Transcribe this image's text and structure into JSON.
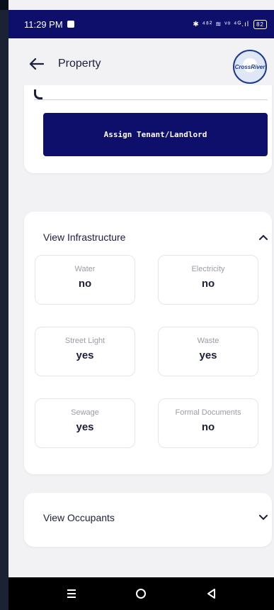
{
  "status_bar": {
    "time": "11:29 PM",
    "icons": "✱ ⁴⁸² ≋ ᵛᵒ ⁴ᴳ.ıl",
    "battery": "82"
  },
  "header": {
    "title": "Property",
    "logo_text": "CrossRiver"
  },
  "actions": {
    "assign_label": "Assign Tenant/Landlord"
  },
  "infrastructure": {
    "title": "View Infrastructure",
    "items": [
      {
        "label": "Water",
        "value": "no"
      },
      {
        "label": "Electricity",
        "value": "no"
      },
      {
        "label": "Street Light",
        "value": "yes"
      },
      {
        "label": "Waste",
        "value": "yes"
      },
      {
        "label": "Sewage",
        "value": "yes"
      },
      {
        "label": "Formal Documents",
        "value": "no"
      }
    ]
  },
  "occupants": {
    "title": "View Occupants"
  },
  "colors": {
    "brand": "#0d0f6b",
    "background": "#f2f2f5",
    "text": "#1b1f3a",
    "muted": "#9a9ca8"
  }
}
